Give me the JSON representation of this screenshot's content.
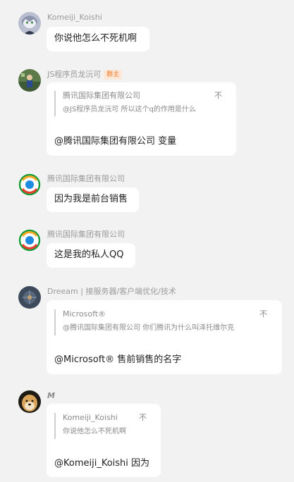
{
  "messages": [
    {
      "sender": "Komeiji_Koishi",
      "text": "你说他怎么不死机啊"
    },
    {
      "sender": "JS程序员龙沅可",
      "badge": "群主",
      "quote": {
        "name": "腾讯国际集团有限公司",
        "text": "@JS程序员龙沅可 所以这个q的作用是什么",
        "close": "不"
      },
      "text": "@腾讯国际集团有限公司 变量"
    },
    {
      "sender": "腾讯国际集团有限公司",
      "text": "因为我是前台销售"
    },
    {
      "sender": "腾讯国际集团有限公司",
      "text": "这是我的私人QQ"
    },
    {
      "sender": "Dreeam | 接服务器/客户端优化/技术",
      "quote": {
        "name": "Microsoft®",
        "text": "@腾讯国际集团有限公司 你们腾讯为什么叫泽托维尔克",
        "close": "不"
      },
      "text": "@Microsoft® 售前销售的名字"
    },
    {
      "sender": "M",
      "quote": {
        "name": "Komeiji_Koishi",
        "text": "你说他怎么不死机啊",
        "close": "不"
      },
      "text": "@Komeiji_Koishi 因为"
    }
  ],
  "colors": {
    "background": "#f2f2f2",
    "bubble": "#ffffff",
    "badge_text": "#f07a2a",
    "badge_bg": "#fde7d6"
  }
}
